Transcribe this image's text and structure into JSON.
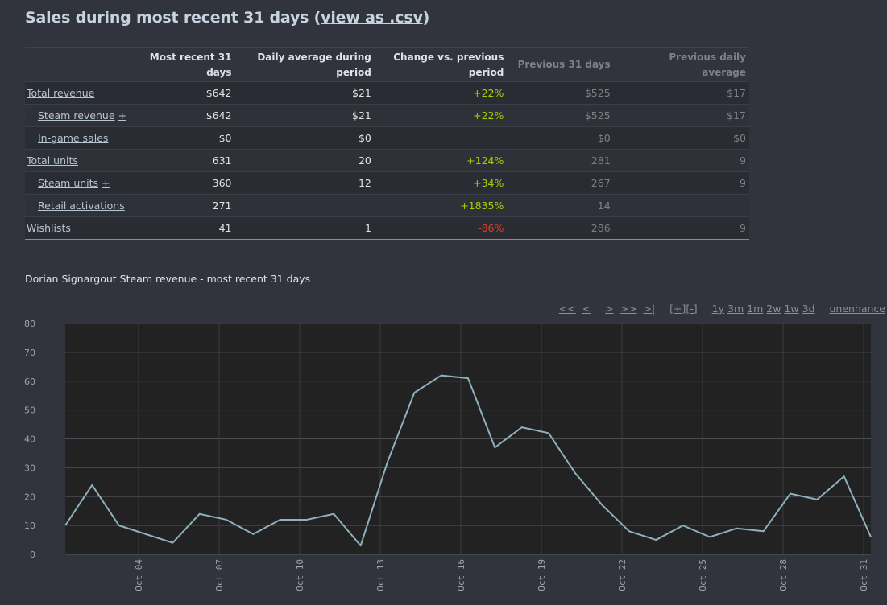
{
  "header": {
    "title_prefix": "Sales during most recent 31 days (",
    "csv_link": "view as .csv",
    "title_suffix": ")"
  },
  "table": {
    "columns": [
      "",
      "Most recent 31 days",
      "Daily average during period",
      "Change vs. previous period",
      "Previous 31 days",
      "Previous daily average"
    ],
    "rows": [
      {
        "label": "Total revenue",
        "plus": "",
        "indent": false,
        "recent": "$642",
        "daily": "$21",
        "change": "+22%",
        "change_sign": "pos",
        "previous": "$525",
        "prev_daily": "$17"
      },
      {
        "label": "Steam revenue",
        "plus": "+",
        "indent": true,
        "recent": "$642",
        "daily": "$21",
        "change": "+22%",
        "change_sign": "pos",
        "previous": "$525",
        "prev_daily": "$17"
      },
      {
        "label": "In-game sales",
        "plus": "",
        "indent": true,
        "recent": "$0",
        "daily": "$0",
        "change": "",
        "change_sign": "",
        "previous": "$0",
        "prev_daily": "$0"
      },
      {
        "label": "Total units",
        "plus": "",
        "indent": false,
        "recent": "631",
        "daily": "20",
        "change": "+124%",
        "change_sign": "pos",
        "previous": "281",
        "prev_daily": "9"
      },
      {
        "label": "Steam units",
        "plus": "+",
        "indent": true,
        "recent": "360",
        "daily": "12",
        "change": "+34%",
        "change_sign": "pos",
        "previous": "267",
        "prev_daily": "9"
      },
      {
        "label": "Retail activations",
        "plus": "",
        "indent": true,
        "recent": "271",
        "daily": "",
        "change": "+1835%",
        "change_sign": "pos",
        "previous": "14",
        "prev_daily": ""
      },
      {
        "label": "Wishlists",
        "plus": "",
        "indent": false,
        "recent": "41",
        "daily": "1",
        "change": "-86%",
        "change_sign": "neg",
        "previous": "286",
        "prev_daily": "9"
      }
    ]
  },
  "chart_section": {
    "title": "Dorian Signargout Steam revenue - most recent 31 days",
    "nav": {
      "first": "<<",
      "prev": "<",
      "next": ">",
      "next_far": ">>",
      "last": ">|",
      "zoom_in": "[+]",
      "zoom_out": "[-]",
      "ranges": [
        "1y",
        "3m",
        "1m",
        "2w",
        "1w",
        "3d"
      ],
      "unenhance": "unenhance"
    }
  },
  "colors": {
    "background": "#31343c",
    "plot_background": "#222222",
    "line": "#8fb0bd",
    "positive": "#a4d007",
    "negative": "#d94126"
  },
  "chart_data": {
    "type": "line",
    "title": "Dorian Signargout Steam revenue - most recent 31 days",
    "xlabel": "",
    "ylabel": "",
    "ylim": [
      0,
      80
    ],
    "yticks": [
      0,
      10,
      20,
      30,
      40,
      50,
      60,
      70,
      80
    ],
    "grid": true,
    "x": [
      "Oct 01",
      "Oct 02",
      "Oct 03",
      "Oct 04",
      "Oct 05",
      "Oct 06",
      "Oct 07",
      "Oct 08",
      "Oct 09",
      "Oct 10",
      "Oct 11",
      "Oct 12",
      "Oct 13",
      "Oct 14",
      "Oct 15",
      "Oct 16",
      "Oct 17",
      "Oct 18",
      "Oct 19",
      "Oct 20",
      "Oct 21",
      "Oct 22",
      "Oct 23",
      "Oct 24",
      "Oct 25",
      "Oct 26",
      "Oct 27",
      "Oct 28",
      "Oct 29",
      "Oct 30",
      "Oct 31"
    ],
    "xtick_labels": [
      "Oct 04",
      "Oct 07",
      "Oct 10",
      "Oct 13",
      "Oct 16",
      "Oct 19",
      "Oct 22",
      "Oct 25",
      "Oct 28",
      "Oct 31"
    ],
    "series": [
      {
        "name": "Steam revenue",
        "values": [
          10,
          24,
          10,
          7,
          4,
          14,
          12,
          7,
          12,
          12,
          14,
          3,
          32,
          56,
          62,
          61,
          37,
          44,
          42,
          28,
          17,
          8,
          5,
          10,
          6,
          9,
          8,
          21,
          19,
          27,
          6
        ]
      }
    ]
  }
}
